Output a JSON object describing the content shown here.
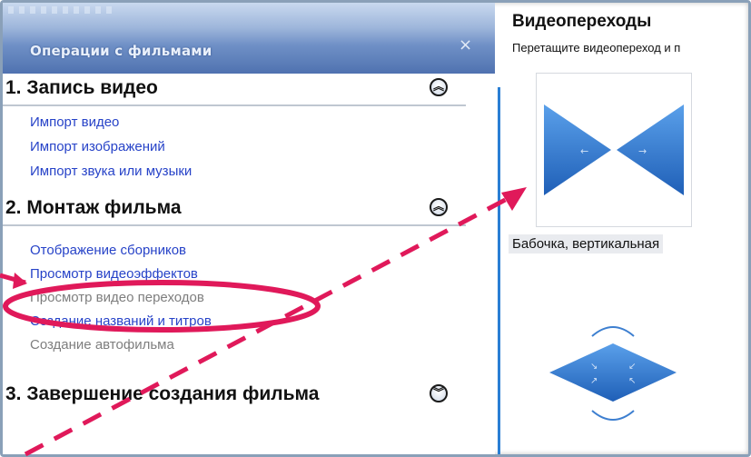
{
  "task_pane": {
    "title": "Операции с фильмами",
    "close_label": "×",
    "sections": [
      {
        "title": "1. Запись видео",
        "expanded": true,
        "links": [
          "Импорт видео",
          "Импорт изображений",
          "Импорт звука или музыки"
        ]
      },
      {
        "title": "2. Монтаж фильма",
        "expanded": true,
        "links": [
          "Отображение сборников",
          "Просмотр видеоэффектов",
          "Просмотр видео переходов",
          "Создание названий и титров",
          "Создание автофильма"
        ]
      },
      {
        "title": "3. Завершение создания фильма",
        "expanded": false
      }
    ]
  },
  "transitions_panel": {
    "title": "Видеопереходы",
    "subtitle": "Перетащите видеопереход и п",
    "items": [
      {
        "label": "Бабочка, вертикальная",
        "icon": "butterfly-vertical-icon"
      },
      {
        "label": "",
        "icon": "diamond-transition-icon"
      }
    ]
  },
  "colors": {
    "link": "#2743c8",
    "disabled_link": "#7e7e7e",
    "annotation": "#e0195a",
    "header": "#4f72b0"
  }
}
